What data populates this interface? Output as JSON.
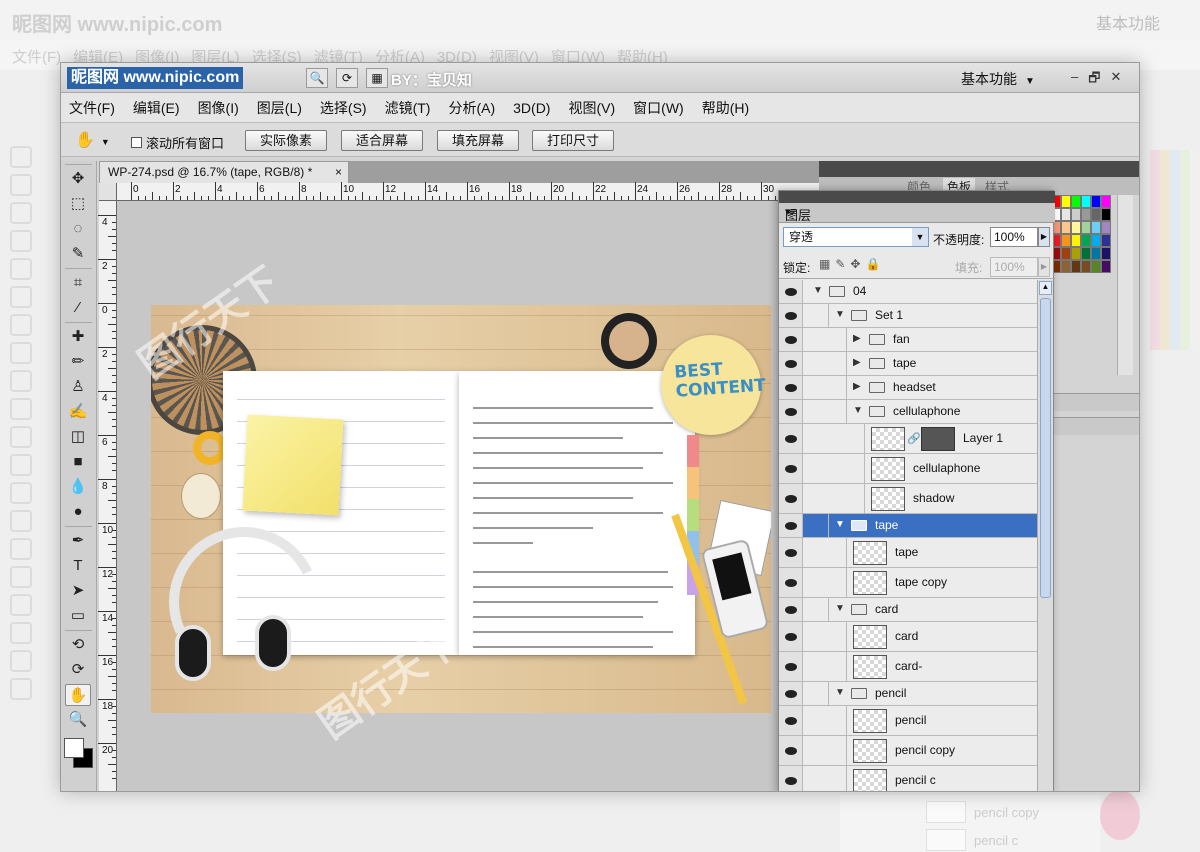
{
  "ghost": {
    "logo": "昵图网 www.nipic.com",
    "workspace": "基本功能",
    "menu": [
      "文件(F)",
      "编辑(E)",
      "图像(I)",
      "图层(L)",
      "选择(S)",
      "滤镜(T)",
      "分析(A)",
      "3D(D)",
      "视图(V)",
      "窗口(W)",
      "帮助(H)"
    ],
    "rows": [
      "pencil copy",
      "pencil c"
    ]
  },
  "title": {
    "logo": "昵图网 www.nipic.com",
    "watermark": "BY：宝贝知",
    "workspace": "基本功能",
    "minimize": "–",
    "restore": "🗗",
    "close": "✕"
  },
  "menu": {
    "items": [
      "文件(F)",
      "编辑(E)",
      "图像(I)",
      "图层(L)",
      "选择(S)",
      "滤镜(T)",
      "分析(A)",
      "3D(D)",
      "视图(V)",
      "窗口(W)",
      "帮助(H)"
    ]
  },
  "options": {
    "scroll_all": "滚动所有窗口",
    "buttons": [
      "实际像素",
      "适合屏幕",
      "填充屏幕",
      "打印尺寸"
    ]
  },
  "document": {
    "tab_title": "WP-274.psd @ 16.7% (tape, RGB/8) *",
    "close": "×",
    "ruler_h": [
      "0",
      "2",
      "4",
      "6",
      "8",
      "10",
      "12",
      "14",
      "16",
      "18",
      "20",
      "22",
      "24",
      "26",
      "28",
      "30"
    ],
    "ruler_v": [
      "4",
      "2",
      "0",
      "2",
      "4",
      "6",
      "8",
      "10",
      "12",
      "14",
      "16",
      "18",
      "20"
    ],
    "art_text": [
      "BEST",
      "CONTENT"
    ],
    "watermark": "图行天下"
  },
  "swatches": {
    "tabs": [
      "颜色",
      "色板",
      "样式"
    ],
    "active": "色板",
    "colors": [
      "#ff0000",
      "#ffff00",
      "#00ff00",
      "#00ffff",
      "#0000ff",
      "#ff00ff",
      "#ffffff",
      "#e6e6e6",
      "#cccccc",
      "#999999",
      "#666666",
      "#000000",
      "#f7977a",
      "#fdc68a",
      "#fff79a",
      "#a2d39c",
      "#6ecff6",
      "#a187be",
      "#ed1c24",
      "#f7941d",
      "#fff200",
      "#00a651",
      "#00aeef",
      "#2e3192",
      "#9e0b0f",
      "#a0410d",
      "#aba000",
      "#007236",
      "#0076a3",
      "#1b1464",
      "#7b2e00",
      "#8c6239",
      "#603913",
      "#754c24",
      "#598527",
      "#440e62"
    ]
  },
  "layers": {
    "panel_title": "图层",
    "blend_mode": "穿透",
    "opacity_label": "不透明度:",
    "opacity": "100%",
    "lock_label": "锁定:",
    "fill_label": "填充:",
    "fill": "100%",
    "rows": [
      {
        "name": "04",
        "kind": "group",
        "level": 0,
        "open": true
      },
      {
        "name": "Set 1",
        "kind": "group",
        "level": 1,
        "open": true
      },
      {
        "name": "fan",
        "kind": "group",
        "level": 2,
        "open": false
      },
      {
        "name": "tape",
        "kind": "group",
        "level": 2,
        "open": false
      },
      {
        "name": "headset",
        "kind": "group",
        "level": 2,
        "open": false
      },
      {
        "name": "cellulaphone",
        "kind": "group",
        "level": 2,
        "open": true
      },
      {
        "name": "Layer 1",
        "kind": "masked",
        "level": 3
      },
      {
        "name": "cellulaphone",
        "kind": "layer",
        "level": 3
      },
      {
        "name": "shadow",
        "kind": "layer",
        "level": 3
      },
      {
        "name": "tape",
        "kind": "group",
        "level": 1,
        "open": true,
        "selected": true
      },
      {
        "name": "tape",
        "kind": "layer",
        "level": 2
      },
      {
        "name": "tape copy",
        "kind": "layer",
        "level": 2
      },
      {
        "name": "card",
        "kind": "group",
        "level": 1,
        "open": true
      },
      {
        "name": "card",
        "kind": "layer",
        "level": 2
      },
      {
        "name": "card-",
        "kind": "layer",
        "level": 2
      },
      {
        "name": "pencil",
        "kind": "group",
        "level": 1,
        "open": true
      },
      {
        "name": "pencil",
        "kind": "layer",
        "level": 2
      },
      {
        "name": "pencil copy",
        "kind": "layer",
        "level": 2
      },
      {
        "name": "pencil c",
        "kind": "layer",
        "level": 2
      }
    ]
  },
  "toolbox": {
    "tools": [
      "move-tool",
      "marquee-tool",
      "lasso-tool",
      "quick-select-tool",
      "crop-tool",
      "eyedropper-tool",
      "healing-tool",
      "brush-tool",
      "clone-stamp-tool",
      "history-brush-tool",
      "eraser-tool",
      "gradient-tool",
      "blur-tool",
      "dodge-tool",
      "pen-tool",
      "type-tool",
      "path-select-tool",
      "shape-tool",
      "3d-rotate-tool",
      "3d-orbit-tool",
      "hand-tool",
      "zoom-tool"
    ],
    "glyphs": [
      "✥",
      "⬚",
      "◌",
      "✎",
      "⌗",
      "⁄",
      "✚",
      "✏",
      "♙",
      "✍",
      "◫",
      "■",
      "💧",
      "●",
      "✒",
      "T",
      "➤",
      "▭",
      "⟲",
      "⟳",
      "✋",
      "🔍"
    ],
    "active": "hand-tool"
  }
}
